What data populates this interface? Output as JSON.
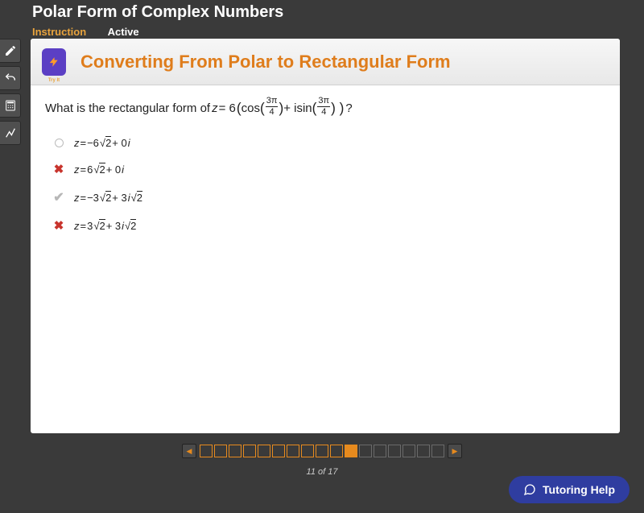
{
  "header": {
    "title": "Polar Form of Complex Numbers",
    "tabs": [
      {
        "label": "Instruction",
        "active": true
      },
      {
        "label": "Active",
        "active": false
      }
    ]
  },
  "sidebar": {
    "items": [
      {
        "name": "pencil-icon"
      },
      {
        "name": "undo-icon"
      },
      {
        "name": "calculator-icon"
      },
      {
        "name": "stats-icon"
      }
    ]
  },
  "banner": {
    "tryit_label": "Try It",
    "title": "Converting From Polar to Rectangular Form"
  },
  "question": {
    "prefix": "What is the rectangular form of ",
    "z_label": "z",
    "equals": " = 6 ",
    "cos_label": "cos",
    "sin_label": "sin",
    "frac_top": "3π",
    "frac_bot": "4",
    "plus_i": " + i ",
    "suffix": "?"
  },
  "options": [
    {
      "mark": "radio",
      "expr": {
        "z": "z",
        "eq": " = ",
        "a": "−6",
        "r1": "2",
        "mid": " + 0",
        "i": "i",
        "b": "",
        "r2": ""
      }
    },
    {
      "mark": "x",
      "expr": {
        "z": "z",
        "eq": " = ",
        "a": "6",
        "r1": "2",
        "mid": " + 0",
        "i": "i",
        "b": "",
        "r2": ""
      }
    },
    {
      "mark": "check",
      "expr": {
        "z": "z",
        "eq": " = ",
        "a": "−3",
        "r1": "2",
        "mid": " + 3",
        "i": "i",
        "b": "",
        "r2": "2"
      }
    },
    {
      "mark": "x",
      "expr": {
        "z": "z",
        "eq": " = ",
        "a": "3",
        "r1": "2",
        "mid": " + 3",
        "i": "i",
        "b": "",
        "r2": "2"
      }
    }
  ],
  "pager": {
    "current": 11,
    "total": 17,
    "text": "11 of 17"
  },
  "tutoring": {
    "label": "Tutoring Help"
  }
}
